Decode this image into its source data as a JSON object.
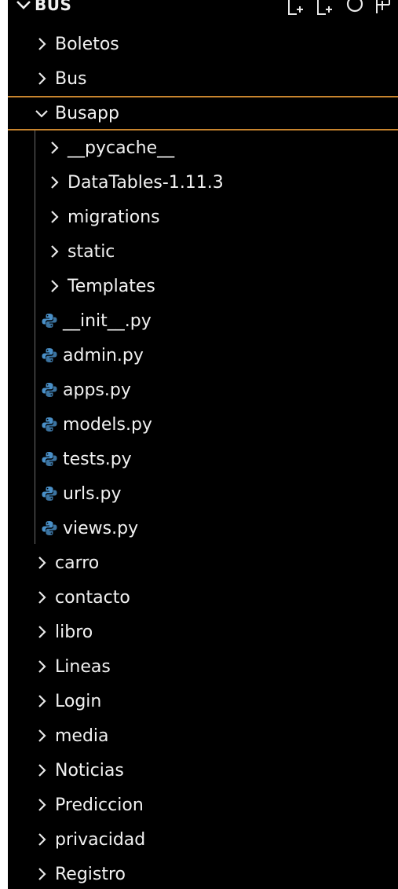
{
  "explorer": {
    "root_title": "BUS",
    "header_actions": [
      {
        "icon": "new-file-icon"
      },
      {
        "icon": "new-folder-icon"
      },
      {
        "icon": "refresh-icon"
      },
      {
        "icon": "collapse-all-icon"
      }
    ],
    "items": [
      {
        "label": "Boletos",
        "type": "folder",
        "level": 0,
        "expanded": false
      },
      {
        "label": "Bus",
        "type": "folder",
        "level": 0,
        "expanded": false
      },
      {
        "label": "Busapp",
        "type": "folder",
        "level": 0,
        "expanded": true,
        "selected": true
      },
      {
        "label": "__pycache__",
        "type": "folder",
        "level": 1,
        "expanded": false
      },
      {
        "label": "DataTables-1.11.3",
        "type": "folder",
        "level": 1,
        "expanded": false
      },
      {
        "label": "migrations",
        "type": "folder",
        "level": 1,
        "expanded": false
      },
      {
        "label": "static",
        "type": "folder",
        "level": 1,
        "expanded": false
      },
      {
        "label": "Templates",
        "type": "folder",
        "level": 1,
        "expanded": false
      },
      {
        "label": "__init__.py",
        "type": "python-file",
        "level": 1
      },
      {
        "label": "admin.py",
        "type": "python-file",
        "level": 1
      },
      {
        "label": "apps.py",
        "type": "python-file",
        "level": 1
      },
      {
        "label": "models.py",
        "type": "python-file",
        "level": 1
      },
      {
        "label": "tests.py",
        "type": "python-file",
        "level": 1
      },
      {
        "label": "urls.py",
        "type": "python-file",
        "level": 1
      },
      {
        "label": "views.py",
        "type": "python-file",
        "level": 1
      },
      {
        "label": "carro",
        "type": "folder",
        "level": 0,
        "expanded": false
      },
      {
        "label": "contacto",
        "type": "folder",
        "level": 0,
        "expanded": false
      },
      {
        "label": "libro",
        "type": "folder",
        "level": 0,
        "expanded": false
      },
      {
        "label": "Lineas",
        "type": "folder",
        "level": 0,
        "expanded": false
      },
      {
        "label": "Login",
        "type": "folder",
        "level": 0,
        "expanded": false
      },
      {
        "label": "media",
        "type": "folder",
        "level": 0,
        "expanded": false
      },
      {
        "label": "Noticias",
        "type": "folder",
        "level": 0,
        "expanded": false
      },
      {
        "label": "Prediccion",
        "type": "folder",
        "level": 0,
        "expanded": false
      },
      {
        "label": "privacidad",
        "type": "folder",
        "level": 0,
        "expanded": false
      },
      {
        "label": "Registro",
        "type": "folder",
        "level": 0,
        "expanded": false
      }
    ]
  },
  "colors": {
    "background": "#000000",
    "text": "#f2f2f2",
    "selection_border": "#c8842e",
    "python_icon": "#4a90c8"
  }
}
